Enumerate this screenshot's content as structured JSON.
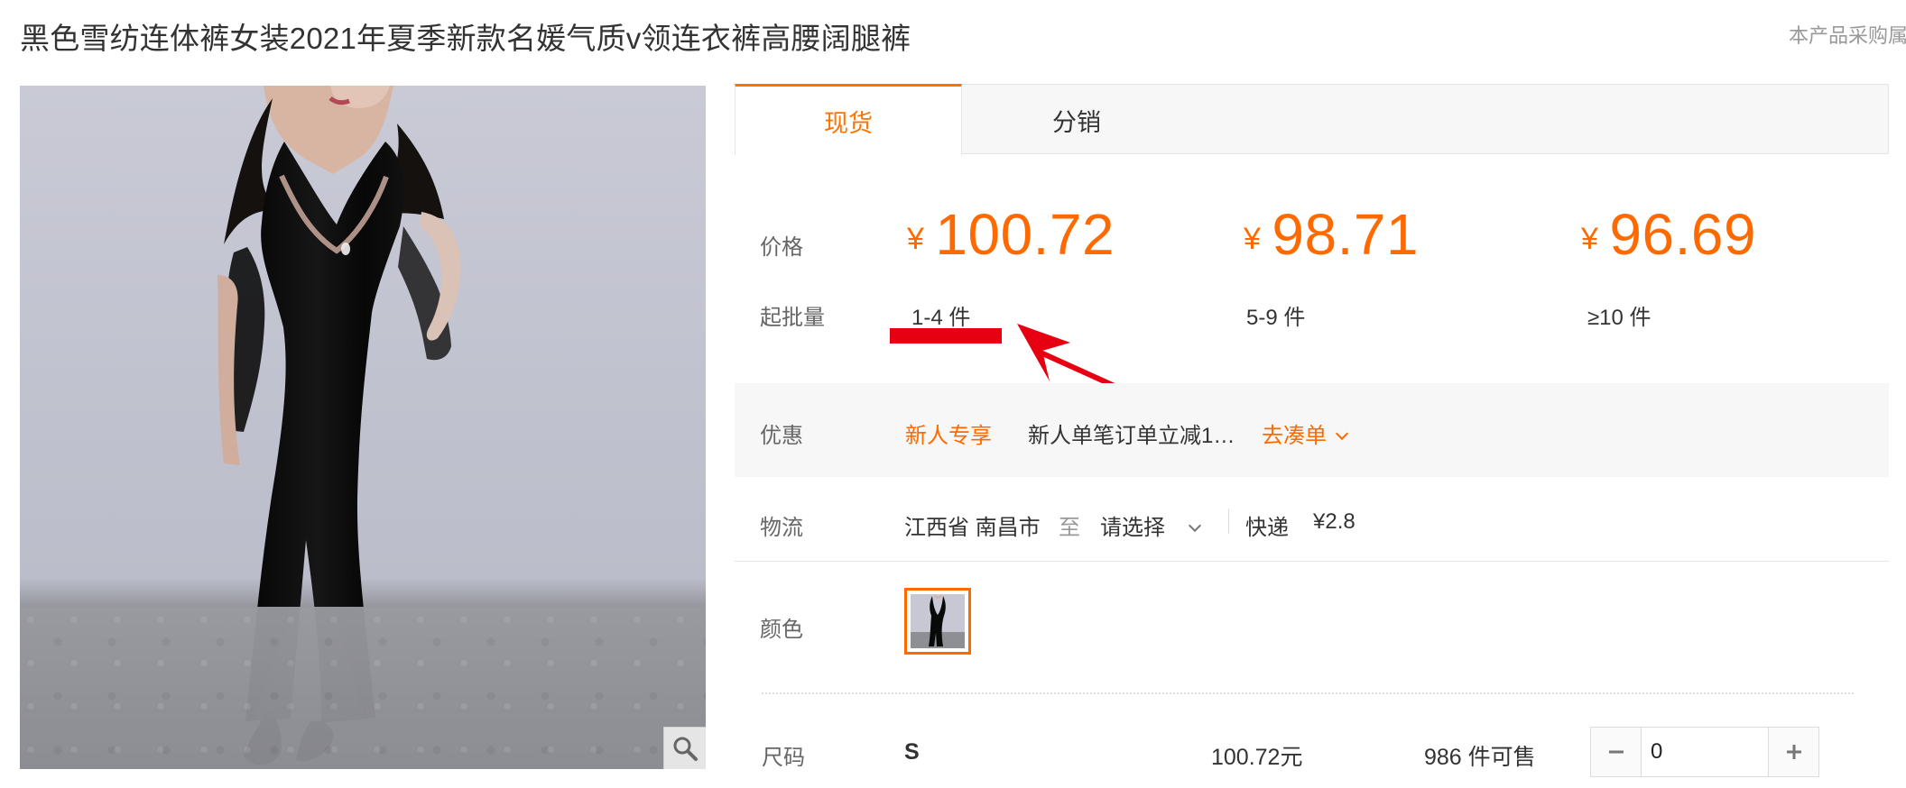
{
  "product": {
    "title": "黑色雪纺连体裤女装2021年夏季新款名媛气质v领连衣裤高腰阔腿裤",
    "top_note": "本产品采购属"
  },
  "tabs": [
    {
      "label": "现货",
      "active": true
    },
    {
      "label": "分销",
      "active": false
    }
  ],
  "pricing": {
    "price_label": "价格",
    "quantity_label": "起批量",
    "currency_symbol": "¥",
    "tiers": [
      {
        "price": "100.72",
        "quantity": "1-4 件"
      },
      {
        "price": "98.71",
        "quantity": "5-9 件"
      },
      {
        "price": "96.69",
        "quantity": "≥10 件"
      }
    ]
  },
  "promotion": {
    "label": "优惠",
    "badge": "新人专享",
    "text": "新人单笔订单立减1…",
    "action": "去凑单"
  },
  "logistics": {
    "label": "物流",
    "origin": "江西省 南昌市",
    "to": "至",
    "destination": "请选择",
    "method": "快递",
    "fee": "¥2.8"
  },
  "color": {
    "label": "颜色"
  },
  "size": {
    "label": "尺码",
    "name": "S",
    "price": "100.72元",
    "stock": "986 件可售",
    "quantity": "0"
  },
  "colors": {
    "accent": "#ff6a00",
    "annotation": "#e60012",
    "text": "#333333",
    "muted": "#666666",
    "panel": "#f7f7f7"
  },
  "icons": {
    "zoom": "magnifier-icon",
    "dropdown": "chevron-down-icon",
    "minus": "minus-icon",
    "plus": "plus-icon"
  }
}
